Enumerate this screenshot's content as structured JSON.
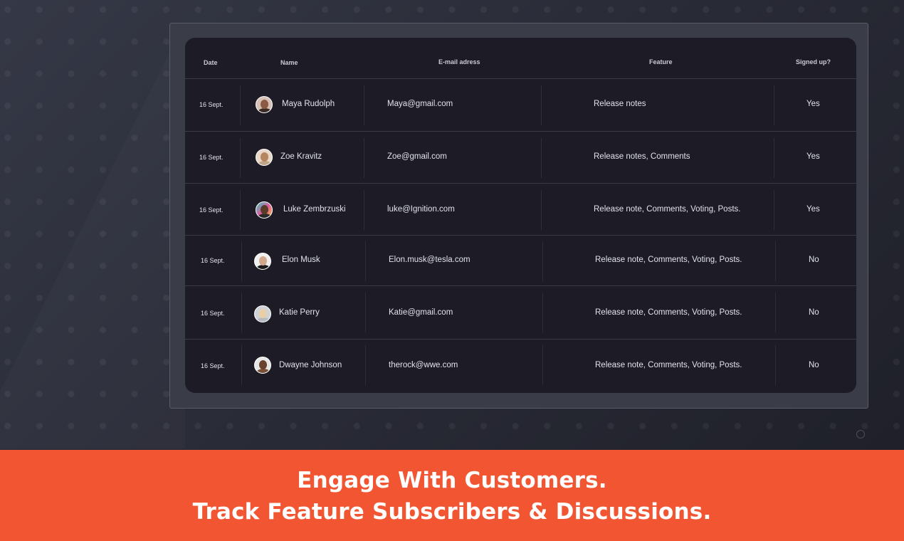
{
  "table": {
    "headers": {
      "date": "Date",
      "name": "Name",
      "email": "E-mail adress",
      "feature": "Feature",
      "signed_up": "Signed up?"
    },
    "rows": [
      {
        "date": "16 Sept.",
        "name": "Maya Rudolph",
        "email": "Maya@gmail.com",
        "feature": "Release notes",
        "signed_up": "Yes",
        "avatar": "maya-avatar"
      },
      {
        "date": "16 Sept.",
        "name": "Zoe Kravitz",
        "email": "Zoe@gmail.com",
        "feature": "Release notes, Comments",
        "signed_up": "Yes",
        "avatar": "zoe-avatar"
      },
      {
        "date": "16 Sept.",
        "name": "Luke Zembrzuski",
        "email": "luke@Ignition.com",
        "feature": "Release note, Comments, Voting,  Posts.",
        "signed_up": "Yes",
        "avatar": "luke-avatar"
      },
      {
        "date": "16 Sept.",
        "name": "Elon Musk",
        "email": "Elon.musk@tesla.com",
        "feature": "Release note, Comments, Voting,  Posts.",
        "signed_up": "No",
        "avatar": "elon-avatar"
      },
      {
        "date": "16 Sept.",
        "name": "Katie Perry",
        "email": "Katie@gmail.com",
        "feature": "Release note, Comments, Voting,  Posts.",
        "signed_up": "No",
        "avatar": "katie-avatar"
      },
      {
        "date": "16 Sept.",
        "name": "Dwayne Johnson",
        "email": "therock@wwe.com",
        "feature": "Release note, Comments, Voting,  Posts.",
        "signed_up": "No",
        "avatar": "dwayne-avatar"
      }
    ]
  },
  "banner": {
    "line1": "Engage With Customers.",
    "line2": "Track Feature Subscribers & Discussions."
  },
  "colors": {
    "banner": "#f15532",
    "table_bg": "#1c1b26",
    "background": "#2a2c38"
  }
}
